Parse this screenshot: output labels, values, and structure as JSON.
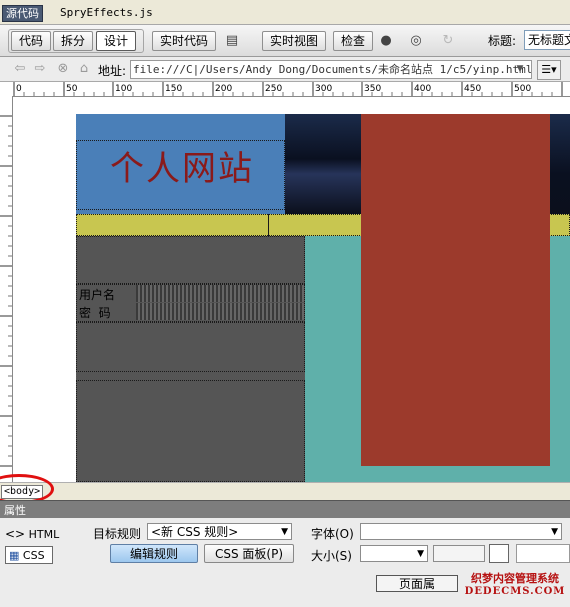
{
  "file_bar": {
    "source_tab": "源代码",
    "related_file": "SpryEffects.js"
  },
  "toolbar": {
    "code": "代码",
    "split": "拆分",
    "design": "设计",
    "live_code": "实时代码",
    "live_view": "实时视图",
    "inspect": "检查",
    "title_label": "标题:",
    "title_value": "无标题文"
  },
  "nav": {
    "address_label": "地址:",
    "address_value": "file:///C|/Users/Andy Dong/Documents/未命名站点 1/c5/yinp.html"
  },
  "ruler": {
    "ticks": [
      "0",
      "50",
      "100",
      "150",
      "200",
      "250",
      "300",
      "350",
      "400",
      "450",
      "500"
    ]
  },
  "page": {
    "site_title": "个人网站",
    "username_label": "用户名",
    "password_label": "密  码"
  },
  "tag_selector": {
    "body": "<body>"
  },
  "properties": {
    "header": "属性",
    "html_tab": "HTML",
    "css_tab": "CSS",
    "target_rule_label": "目标规则",
    "target_rule_value": "<新 CSS 规则>",
    "edit_rule_button": "编辑规则",
    "css_panel_button": "CSS 面板(P)",
    "font_label": "字体(O)",
    "size_label": "大小(S)",
    "page_properties_button": "页面属",
    "watermark_line1": "织梦内容管理系统",
    "watermark_line2": "DEDECMS.COM"
  }
}
